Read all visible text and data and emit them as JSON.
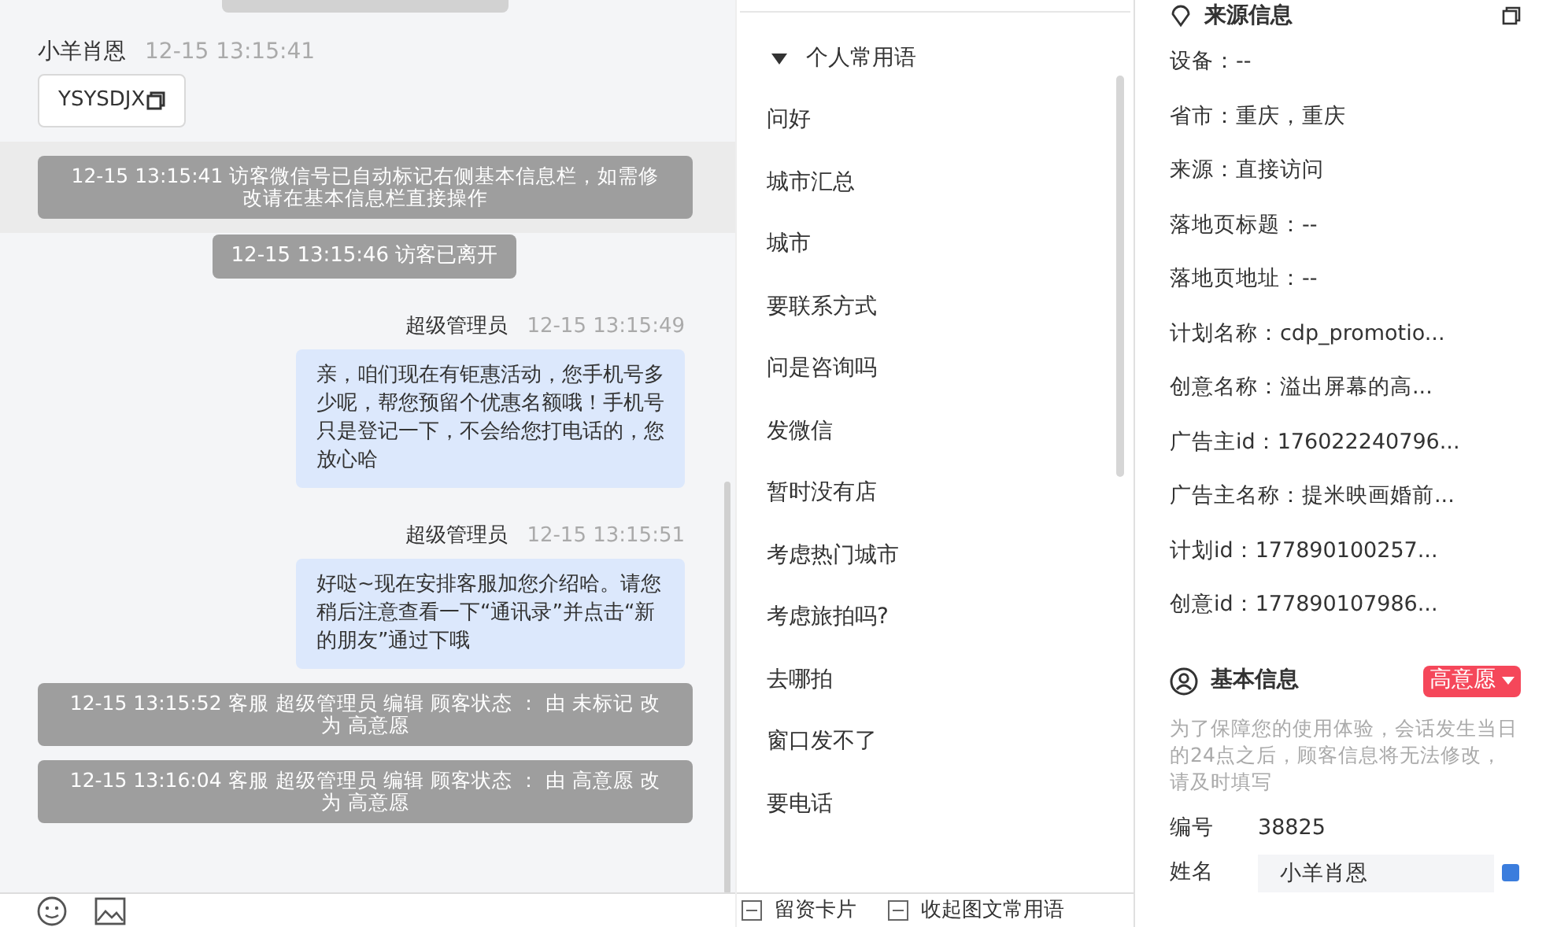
{
  "chat": {
    "messages": [
      {
        "kind": "incoming",
        "sender": "小羊肖恩",
        "time": "12-15 13:15:41",
        "text": "YSYSDJX"
      },
      {
        "kind": "system",
        "highlighted": true,
        "text": "12-15 13:15:41 访客微信号已自动标记右侧基本信息栏，如需修改请在基本信息栏直接操作"
      },
      {
        "kind": "notice",
        "text": "12-15 13:15:46 访客已离开"
      },
      {
        "kind": "outgoing",
        "sender": "超级管理员",
        "time": "12-15 13:15:49",
        "text": "亲，咱们现在有钜惠活动，您手机号多少呢，帮您预留个优惠名额哦！手机号只是登记一下，不会给您打电话的，您放心哈"
      },
      {
        "kind": "outgoing",
        "sender": "超级管理员",
        "time": "12-15 13:15:51",
        "text": "好哒~现在安排客服加您介绍哈。请您稍后注意查看一下“通讯录”并点击“新的朋友”通过下哦"
      },
      {
        "kind": "system",
        "highlighted": false,
        "text": "12-15 13:15:52 客服 超级管理员 编辑 顾客状态 ： 由 未标记 改为 高意愿"
      },
      {
        "kind": "system",
        "highlighted": false,
        "text": "12-15 13:16:04 客服 超级管理员 编辑 顾客状态 ： 由 高意愿 改为 高意愿"
      }
    ]
  },
  "quick_replies": {
    "group": {
      "label": "个人常用语",
      "expanded": true,
      "items": [
        "问好",
        "城市汇总",
        "城市",
        "要联系方式",
        "问是咨询吗",
        "发微信",
        "暂时没有店",
        "考虑热门城市",
        "考虑旅拍吗?",
        "去哪拍",
        "窗口发不了",
        "要电话"
      ]
    },
    "actions": [
      "留资卡片",
      "收起图文常用语"
    ]
  },
  "source_info": {
    "title": "来源信息",
    "fields": [
      "设备：--",
      "省市：重庆，重庆",
      "来源：直接访问",
      "落地页标题：--",
      "落地页地址：--",
      "计划名称：cdp_promotio...",
      "创意名称：溢出屏幕的高...",
      "广告主id：176022240796...",
      "广告主名称：提米映画婚前...",
      "计划id：177890100257...",
      "创意id：177890107986..."
    ]
  },
  "basic_info": {
    "title": "基本信息",
    "intent": {
      "label": "高意愿",
      "color": "#f5475a"
    },
    "note": "为了保障您的使用体验，会话发生当日的24点之后，顾客信息将无法修改，请及时填写",
    "fields": [
      {
        "kind": "text",
        "label": "编号",
        "value": "38825"
      },
      {
        "kind": "input",
        "label": "姓名",
        "value": "小羊肖恩"
      }
    ]
  }
}
